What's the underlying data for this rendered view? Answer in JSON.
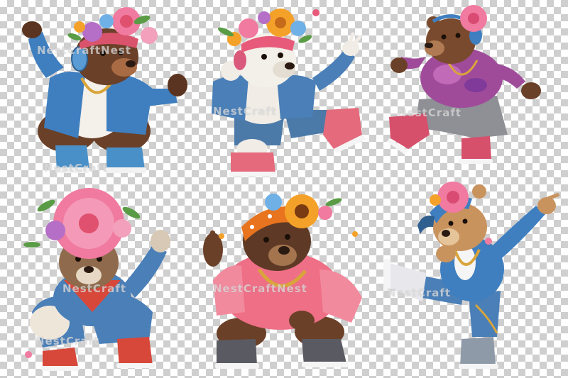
{
  "watermark": {
    "text": "NestCraftNest",
    "text_alt": "NestCraft"
  },
  "colors": {
    "checker_light": "#ffffff",
    "checker_dark": "#cfcfcf",
    "bear_brown": "#6b4028",
    "bear_cream": "#f1ede6",
    "bear_tan": "#c9935e",
    "denim": "#3f7fc0",
    "pink_hoodie": "#ee6f86",
    "purple_hoodie": "#a04b9a",
    "flower_pink": "#f07aa0",
    "flower_orange": "#f4a12a",
    "gold_chain": "#d9a53a"
  },
  "figures": [
    {
      "id": "bear-1",
      "color_name": "brown",
      "pose": "pointing",
      "accessories": [
        "flower-crown",
        "headphones",
        "denim-jacket",
        "gold-chain",
        "sneakers"
      ]
    },
    {
      "id": "bear-2",
      "color_name": "white",
      "pose": "peace-sign",
      "accessories": [
        "flower-crown",
        "cap",
        "denim-jacket",
        "pink-sneakers"
      ]
    },
    {
      "id": "bear-3",
      "color_name": "brown",
      "pose": "dancing",
      "accessories": [
        "flower",
        "headphones",
        "purple-hoodie",
        "grey-pants"
      ]
    },
    {
      "id": "bear-4",
      "color_name": "tan",
      "pose": "crouching",
      "accessories": [
        "large-pink-flower",
        "red-bandana",
        "denim-outfit",
        "red-sneakers"
      ]
    },
    {
      "id": "bear-5",
      "color_name": "brown",
      "pose": "pointing",
      "accessories": [
        "orange-bandana",
        "sunflower",
        "pink-hoodie",
        "gold-chain",
        "sneakers"
      ]
    },
    {
      "id": "bear-6",
      "color_name": "tan",
      "pose": "dab-kick",
      "accessories": [
        "flower",
        "backwards-cap",
        "denim-jacket",
        "gold-chain",
        "sneakers"
      ]
    }
  ]
}
